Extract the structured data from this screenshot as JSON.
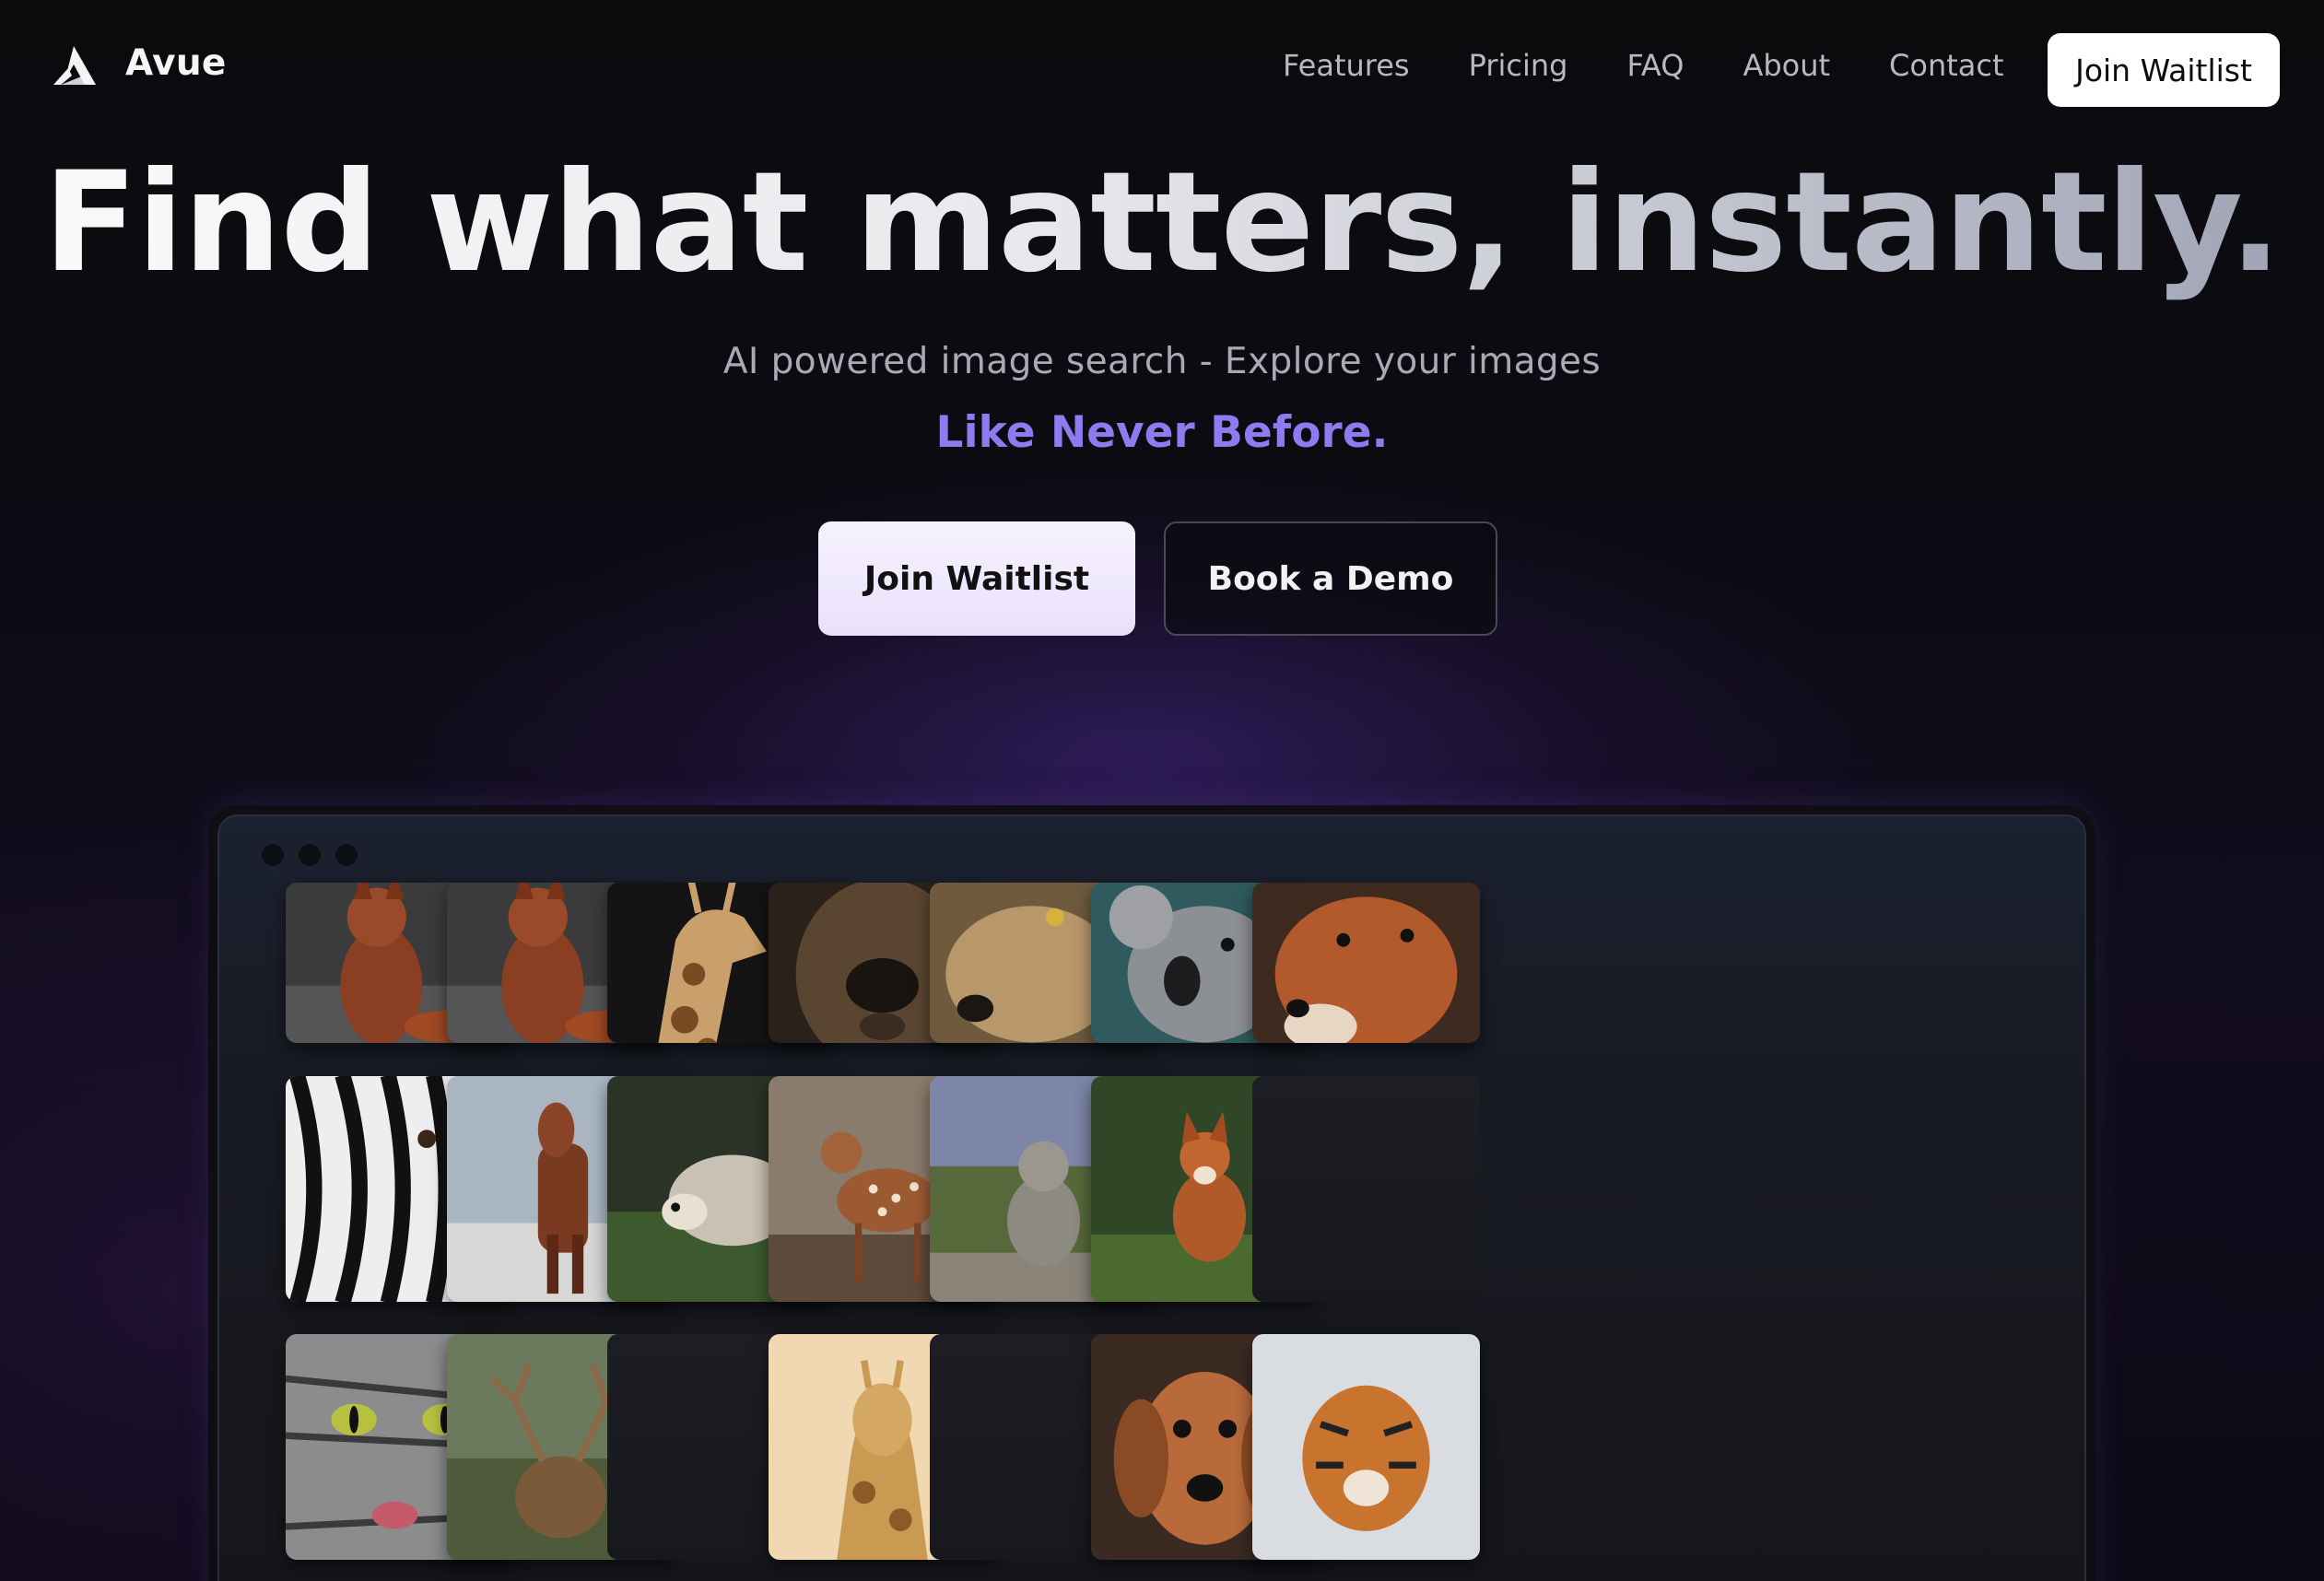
{
  "brand": {
    "name": "Avue",
    "logo_icon": "avue-logo-icon"
  },
  "nav": {
    "links": [
      "Features",
      "Pricing",
      "FAQ",
      "About",
      "Contact"
    ],
    "cta": "Join Waitlist"
  },
  "hero": {
    "title": "Find what matters, instantly.",
    "subtitle": "AI powered image search - Explore your images",
    "accent": "Like Never Before.",
    "primary_button": "Join Waitlist",
    "secondary_button": "Book a Demo"
  },
  "colors": {
    "accent": "#8e7bf0",
    "background": "#0a0a0d",
    "primary_button_bg": "#efe8fd"
  },
  "gallery": {
    "rows": [
      [
        "red-fox-sitting",
        "red-fox-sitting",
        "giraffe",
        "lion",
        "wolf",
        "koala",
        "red-fox-face"
      ],
      [
        "zebra",
        "horse",
        "hedgehog",
        "fawn",
        "monkey",
        "fox-in-grass",
        "empty"
      ],
      [
        "cat",
        "elk",
        "empty",
        "giraffe-portrait",
        "empty",
        "dachshund",
        "tiger"
      ]
    ]
  }
}
